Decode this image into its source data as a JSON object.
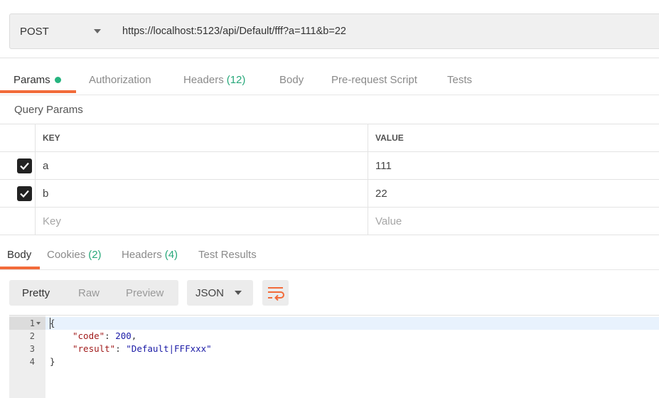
{
  "request": {
    "method": "POST",
    "url": "https://localhost:5123/api/Default/fff?a=111&b=22"
  },
  "request_tabs": {
    "params": "Params",
    "authorization": "Authorization",
    "headers": "Headers",
    "headers_count": "(12)",
    "body": "Body",
    "prerequest": "Pre-request Script",
    "tests": "Tests"
  },
  "query_params": {
    "title": "Query Params",
    "col_key": "KEY",
    "col_value": "VALUE",
    "rows": [
      {
        "checked": true,
        "key": "a",
        "value": "111"
      },
      {
        "checked": true,
        "key": "b",
        "value": "22"
      }
    ],
    "placeholder_key": "Key",
    "placeholder_value": "Value"
  },
  "response_tabs": {
    "body": "Body",
    "cookies": "Cookies",
    "cookies_count": "(2)",
    "headers": "Headers",
    "headers_count": "(4)",
    "test_results": "Test Results"
  },
  "response_view": {
    "pretty": "Pretty",
    "raw": "Raw",
    "preview": "Preview",
    "format": "JSON"
  },
  "response_body": {
    "line_numbers": [
      "1",
      "2",
      "3",
      "4"
    ],
    "open_brace": "{",
    "code_key": "\"code\"",
    "code_value": "200",
    "result_key": "\"result\"",
    "result_value": "\"Default|FFFxxx\"",
    "close_brace": "}"
  },
  "colors": {
    "accent": "#f26b3a",
    "count_green": "#27a87a",
    "dot_green": "#26b47f"
  }
}
